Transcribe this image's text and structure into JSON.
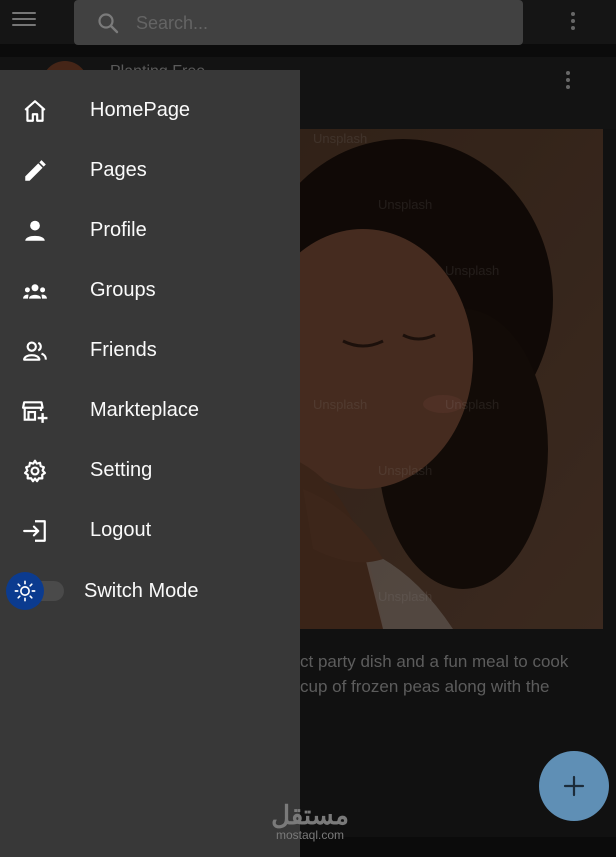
{
  "search": {
    "placeholder": "Search..."
  },
  "post": {
    "author": "Planting Free",
    "image_watermarks": [
      "Unsplash",
      "Unsplash",
      "Unsplash",
      "Unsplash",
      "Unsplash",
      "Unsplash",
      "Unsplash"
    ],
    "text_lines": [
      "ct party dish and a fun meal to cook",
      "cup of frozen peas along with the"
    ]
  },
  "drawer": {
    "items": [
      {
        "label": "HomePage",
        "icon": "home-icon"
      },
      {
        "label": "Pages",
        "icon": "pencil-icon"
      },
      {
        "label": "Profile",
        "icon": "person-icon"
      },
      {
        "label": "Groups",
        "icon": "groups-icon"
      },
      {
        "label": "Friends",
        "icon": "friends-icon"
      },
      {
        "label": "Markteplace",
        "icon": "storefront-icon"
      },
      {
        "label": "Setting",
        "icon": "gear-icon"
      },
      {
        "label": "Logout",
        "icon": "logout-icon"
      }
    ],
    "switch_mode": {
      "label": "Switch Mode",
      "icon": "sun-icon",
      "on": true
    }
  },
  "fab": {
    "icon": "plus-icon"
  },
  "watermark": {
    "arabic": "مستقل",
    "latin": "mostaql.com"
  },
  "colors": {
    "drawer_bg": "#383838",
    "appbar_bg": "#212121",
    "search_bg": "#646464",
    "switch_thumb": "#0b3b8f",
    "fab_bg": "#5f8fb5"
  }
}
